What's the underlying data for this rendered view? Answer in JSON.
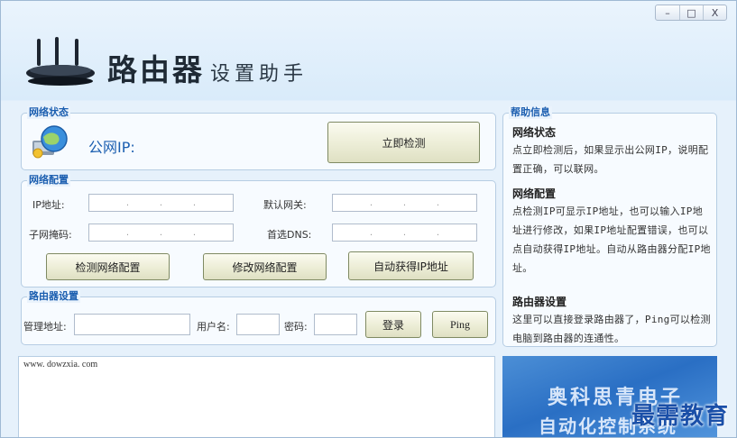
{
  "window": {
    "controls": {
      "minimize": "–",
      "maximize": "□",
      "close": "X"
    }
  },
  "header": {
    "title_main": "路由器",
    "title_sub": "设置助手",
    "logo_icon": "router-icon"
  },
  "network_status": {
    "title": "网络状态",
    "icon": "globe-network-icon",
    "public_ip_label": "公网IP:",
    "public_ip_value": "",
    "detect_button": "立即检测"
  },
  "network_config": {
    "title": "网络配置",
    "ip_label": "IP地址:",
    "gateway_label": "默认网关:",
    "mask_label": "子网掩码:",
    "dns_label": "首选DNS:",
    "ip_dots": ".  .  .",
    "buttons": {
      "check": "检测网络配置",
      "modify": "修改网络配置",
      "auto": "自动获得IP地址"
    }
  },
  "router_settings": {
    "title": "路由器设置",
    "address_label": "管理地址:",
    "address_value": "",
    "user_label": "用户名:",
    "user_value": "",
    "password_label": "密码:",
    "password_value": "",
    "login_button": "登录",
    "ping_button": "Ping"
  },
  "help": {
    "title": "帮助信息",
    "sections": [
      {
        "heading": "网络状态",
        "text": "点立即检测后，如果显示出公网IP，说明配置正确，可以联网。"
      },
      {
        "heading": "网络配置",
        "text": "点检测IP可显示IP地址，也可以输入IP地址进行修改，如果IP地址配置错误，也可以点自动获得IP地址。自动从路由器分配IP地址。"
      },
      {
        "heading": "路由器设置",
        "text": "这里可以直接登录路由器了，Ping可以检测电脑到路由器的连通性。"
      }
    ]
  },
  "log": {
    "text": "www. dowzxia. com"
  },
  "banner": {
    "line1": "奥科思青电子",
    "line2": "自动化控制系统"
  },
  "watermark": {
    "text": "最需教育"
  },
  "colors": {
    "accent": "#1c5fb0",
    "window_bg": "#e6f1fb",
    "button_bg": "#ecedd6"
  }
}
